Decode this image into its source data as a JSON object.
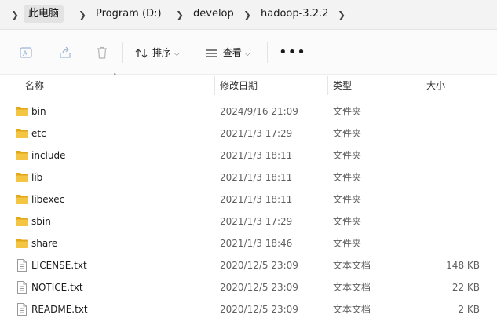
{
  "breadcrumb": {
    "items": [
      "此电脑",
      "Program (D:)",
      "develop",
      "hadoop-3.2.2"
    ]
  },
  "toolbar": {
    "sort_label": "排序",
    "view_label": "查看",
    "more_label": "•••"
  },
  "columns": {
    "name": "名称",
    "date": "修改日期",
    "type": "类型",
    "size": "大小"
  },
  "files": [
    {
      "name": "bin",
      "date": "2024/9/16 21:09",
      "type": "文件夹",
      "size": "",
      "kind": "folder"
    },
    {
      "name": "etc",
      "date": "2021/1/3 17:29",
      "type": "文件夹",
      "size": "",
      "kind": "folder"
    },
    {
      "name": "include",
      "date": "2021/1/3 18:11",
      "type": "文件夹",
      "size": "",
      "kind": "folder"
    },
    {
      "name": "lib",
      "date": "2021/1/3 18:11",
      "type": "文件夹",
      "size": "",
      "kind": "folder"
    },
    {
      "name": "libexec",
      "date": "2021/1/3 18:11",
      "type": "文件夹",
      "size": "",
      "kind": "folder"
    },
    {
      "name": "sbin",
      "date": "2021/1/3 17:29",
      "type": "文件夹",
      "size": "",
      "kind": "folder"
    },
    {
      "name": "share",
      "date": "2021/1/3 18:46",
      "type": "文件夹",
      "size": "",
      "kind": "folder"
    },
    {
      "name": "LICENSE.txt",
      "date": "2020/12/5 23:09",
      "type": "文本文档",
      "size": "148 KB",
      "kind": "text"
    },
    {
      "name": "NOTICE.txt",
      "date": "2020/12/5 23:09",
      "type": "文本文档",
      "size": "22 KB",
      "kind": "text"
    },
    {
      "name": "README.txt",
      "date": "2020/12/5 23:09",
      "type": "文本文档",
      "size": "2 KB",
      "kind": "text"
    }
  ],
  "colors": {
    "folder": "#f4c542",
    "folder_dark": "#e2a81c",
    "icon_gray": "#9a9a9a"
  }
}
